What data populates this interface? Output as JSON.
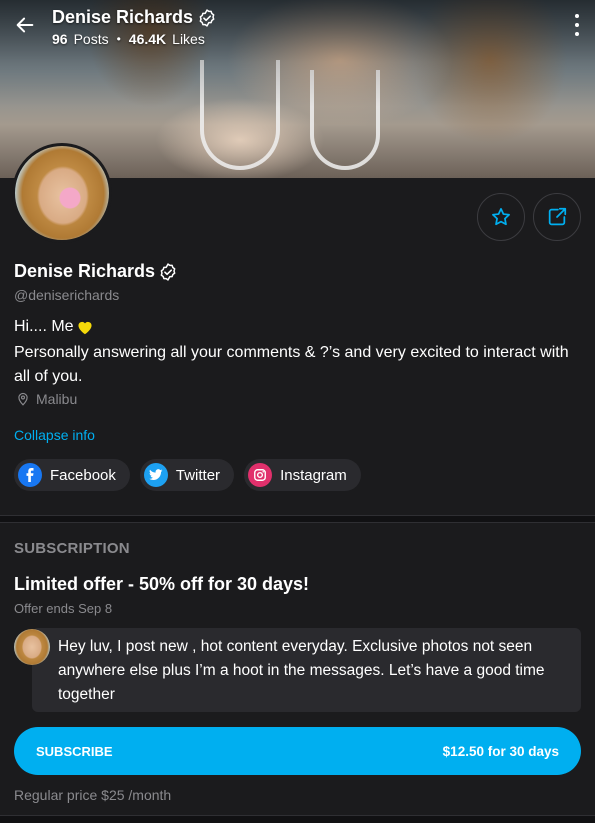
{
  "header": {
    "name": "Denise Richards",
    "posts_count": "96",
    "posts_label": "Posts",
    "separator": "•",
    "likes_count": "46.4K",
    "likes_label": "Likes"
  },
  "profile": {
    "name": "Denise Richards",
    "handle": "@deniserichards",
    "bio_line1": "Hi.... Me",
    "bio_line2": "Personally answering all your comments & ?’s and very excited to interact with all of you.",
    "location": "Malibu",
    "collapse_label": "Collapse info"
  },
  "socials": [
    {
      "label": "Facebook",
      "color": "#1877f2",
      "icon": "facebook-icon"
    },
    {
      "label": "Twitter",
      "color": "#1da1f2",
      "icon": "twitter-icon"
    },
    {
      "label": "Instagram",
      "color": "#e1306c",
      "icon": "instagram-icon"
    }
  ],
  "subscription": {
    "heading": "SUBSCRIPTION",
    "offer_title": "Limited offer - 50% off for 30 days!",
    "offer_ends": "Offer ends Sep 8",
    "message": "Hey luv, I post new , hot content everyday. Exclusive photos not seen anywhere else plus I’m a hoot in the messages. Let’s have a good time together",
    "button_label": "SUBSCRIBE",
    "button_price": "$12.50 for 30 days",
    "regular_price": "Regular price $25 /month"
  },
  "colors": {
    "accent": "#00aff0",
    "background": "#1b1b1d",
    "muted": "#8a8a8e",
    "heart": "#f5d90a"
  }
}
